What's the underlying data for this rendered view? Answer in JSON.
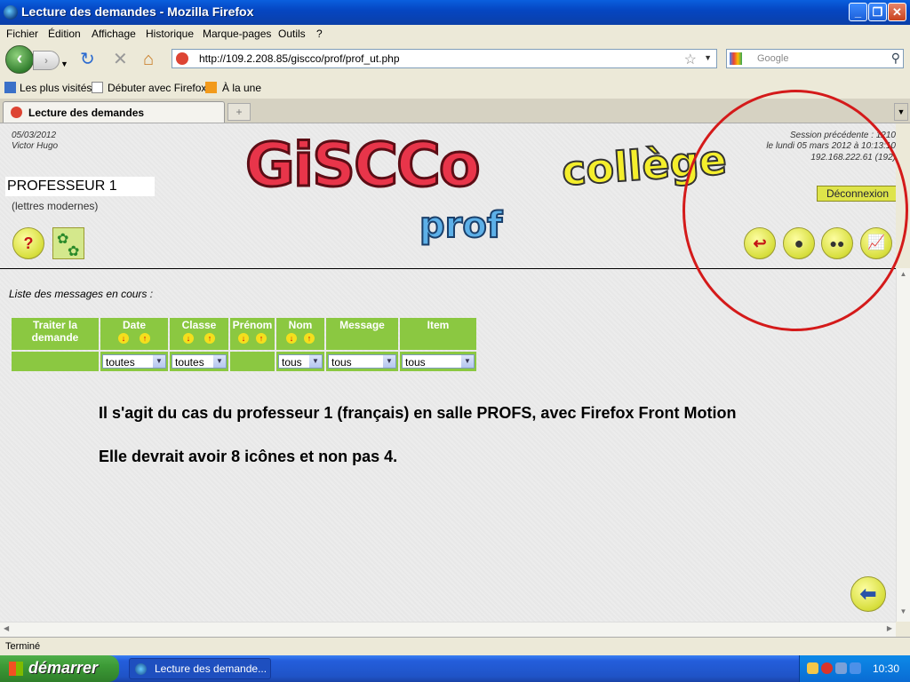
{
  "window": {
    "title": "Lecture des demandes - Mozilla Firefox"
  },
  "menu": [
    "Fichier",
    "Édition",
    "Affichage",
    "Historique",
    "Marque-pages",
    "Outils",
    "?"
  ],
  "nav": {
    "url": "http://109.2.208.85/giscco/prof/prof_ut.php",
    "search_placeholder": "Google"
  },
  "bookmarks": [
    "Les plus visités",
    "Débuter avec Firefox",
    "À la une"
  ],
  "tab": {
    "label": "Lecture des demandes"
  },
  "header": {
    "date": "05/03/2012",
    "school": "Victor Hugo",
    "user_name": "PROFESSEUR 1",
    "user_subject": "(lettres modernes)",
    "logo_main": "GiSCCo",
    "logo_sub": "prof",
    "logo_college": "collège",
    "session_line1": "Session précédente : 1210",
    "session_line2": "le lundi 05 mars 2012 à 10:13:10",
    "session_line3": "192.168.222.61 (192)",
    "logout_label": "Déconnexion"
  },
  "list": {
    "title": "Liste des messages en cours :",
    "columns": [
      {
        "label": "Traiter la demande",
        "sortable": false
      },
      {
        "label": "Date",
        "sortable": true
      },
      {
        "label": "Classe",
        "sortable": true
      },
      {
        "label": "Prénom",
        "sortable": true
      },
      {
        "label": "Nom",
        "sortable": true
      },
      {
        "label": "Message",
        "sortable": false
      },
      {
        "label": "Item",
        "sortable": false
      }
    ],
    "filters": {
      "date": "toutes",
      "classe": "toutes",
      "nom": "tous",
      "message": "tous",
      "item": "tous"
    }
  },
  "notes": {
    "line1": "Il s'agit du cas du professeur 1 (français) en salle PROFS, avec Firefox Front Motion",
    "line2": "Elle devrait avoir 8 icônes et non pas 4."
  },
  "status": {
    "text": "Terminé"
  },
  "taskbar": {
    "start_label": "démarrer",
    "task_label": "Lecture des demande...",
    "clock": "10:30"
  }
}
